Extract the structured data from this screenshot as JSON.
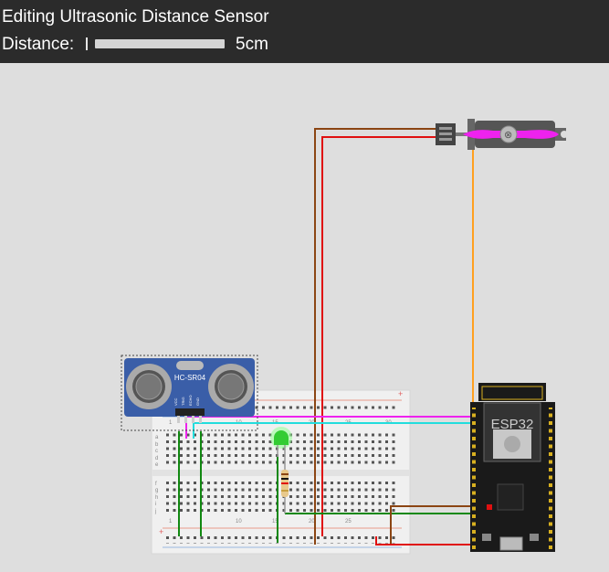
{
  "header": {
    "title": "Editing Ultrasonic Distance Sensor",
    "distance_label": "Distance:",
    "distance_value": "5cm",
    "slider_fraction": 0.0
  },
  "components": {
    "sensor_label": "HC-SR04",
    "sensor_pins": [
      "VCC",
      "TRIG",
      "ECHO",
      "GND"
    ],
    "mcu_label": "ESP32",
    "breadboard_column_labels": [
      "1",
      "10",
      "15",
      "20",
      "25",
      "30"
    ],
    "breadboard_row_labels": [
      "a",
      "b",
      "c",
      "d",
      "e",
      "f",
      "g",
      "h",
      "i",
      "j"
    ]
  },
  "colors": {
    "header_bg": "#2b2b2b",
    "canvas_bg": "#dedede",
    "wire_red": "#e01010",
    "wire_brown": "#8b4513",
    "wire_orange": "#ffa020",
    "wire_magenta": "#ee22ee",
    "wire_cyan": "#22dddd",
    "wire_green": "#118811",
    "led_green": "#33cc33"
  }
}
